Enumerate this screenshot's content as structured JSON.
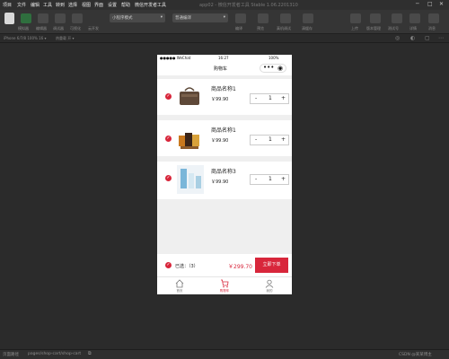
{
  "menubar": {
    "items": [
      "项目",
      "文件",
      "编辑",
      "工具",
      "转到",
      "选择",
      "视图",
      "界面",
      "设置",
      "帮助",
      "微信开发者工具"
    ],
    "center": "app02 - 微信开发者工具 Stable 1.06.2201310",
    "controls": [
      "─",
      "□",
      "✕"
    ]
  },
  "toolbar": {
    "left_labels": [
      "模拟器",
      "编辑器",
      "调试器",
      "可视化",
      "云开发"
    ],
    "mode_select": "小程序模式",
    "compile_select": "普通编译",
    "mid_labels": [
      "编译",
      "预览",
      "真机调试",
      "清缓存"
    ],
    "right_labels": [
      "上传",
      "版本管理",
      "测试号",
      "详情",
      "消息"
    ]
  },
  "simulator": {
    "device": "iPhone 6/7/8 100% 16 ▾",
    "hotreload": "热重载 开 ▾"
  },
  "phone": {
    "status": {
      "signal": "●●●●● WeChat",
      "time": "16:27",
      "battery": "100%"
    },
    "title": "购物车",
    "items": [
      {
        "name": "商品名称1",
        "price": "￥99.90",
        "qty": "1",
        "minus": "-",
        "plus": "+"
      },
      {
        "name": "商品名称1",
        "price": "￥99.90",
        "qty": "1",
        "minus": "-",
        "plus": "+"
      },
      {
        "name": "商品名称3",
        "price": "￥99.90",
        "qty": "1",
        "minus": "-",
        "plus": "+"
      }
    ],
    "footer": {
      "selected": "已选：（3）",
      "total": "￥299.70",
      "order_btn": "立即下单"
    },
    "tabs": [
      "首页",
      "购物车",
      "我的"
    ]
  },
  "bottombar": {
    "left": "页面路径",
    "path": "pages/shop-cart/shop-cart",
    "right": "CSDN @某某博主"
  },
  "colors": {
    "accent": "#d8263b",
    "toolbar_bg": "#353535",
    "app_bg": "#2b2b2b"
  }
}
